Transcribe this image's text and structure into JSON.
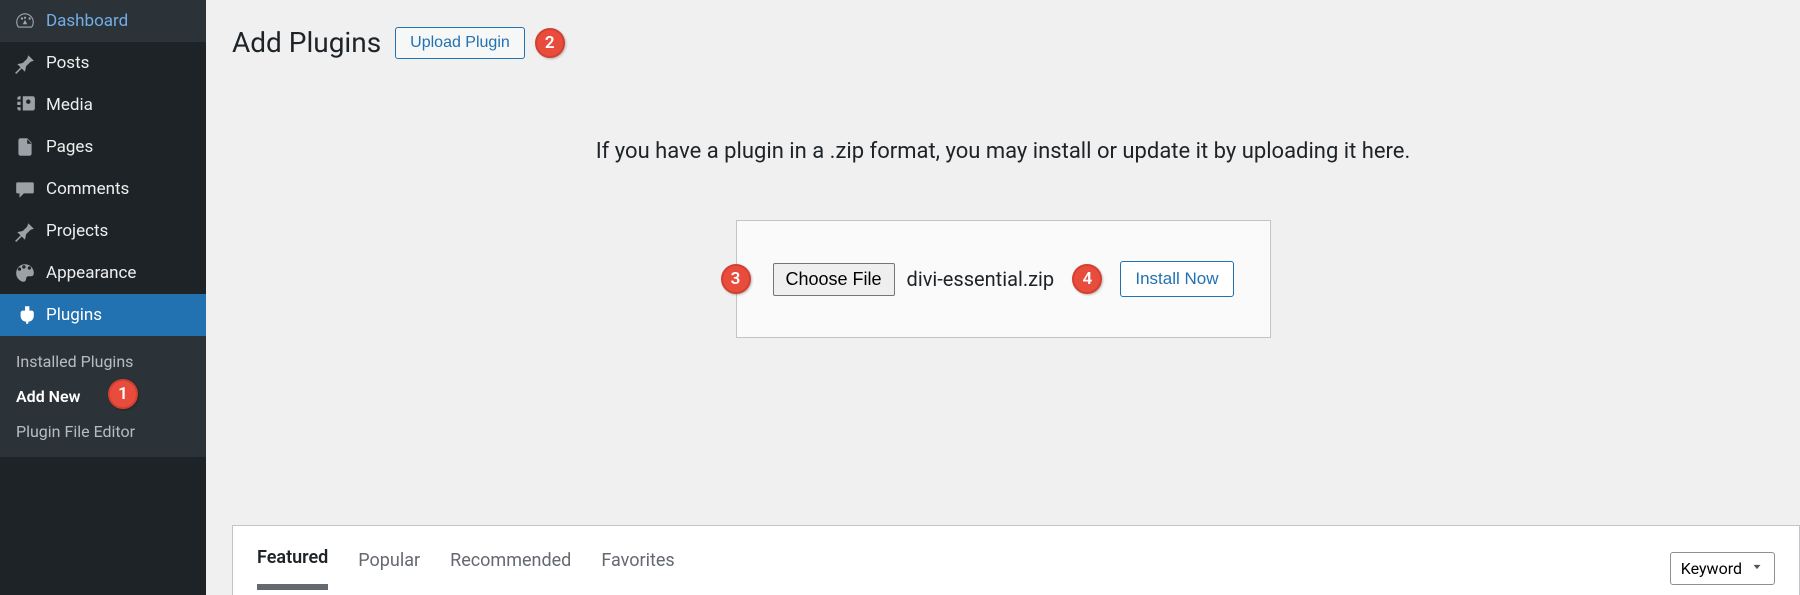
{
  "sidebar": {
    "items": [
      {
        "label": "Dashboard",
        "icon": "dashboard"
      },
      {
        "label": "Posts",
        "icon": "pin"
      },
      {
        "label": "Media",
        "icon": "media"
      },
      {
        "label": "Pages",
        "icon": "pages"
      },
      {
        "label": "Comments",
        "icon": "comments"
      },
      {
        "label": "Projects",
        "icon": "pin"
      },
      {
        "label": "Appearance",
        "icon": "appearance"
      },
      {
        "label": "Plugins",
        "icon": "plugins"
      }
    ],
    "submenu": {
      "items": [
        {
          "label": "Installed Plugins"
        },
        {
          "label": "Add New"
        },
        {
          "label": "Plugin File Editor"
        }
      ]
    }
  },
  "header": {
    "title": "Add Plugins",
    "upload_button": "Upload Plugin"
  },
  "upload": {
    "message": "If you have a plugin in a .zip format, you may install or update it by uploading it here.",
    "choose_file_label": "Choose File",
    "file_name": "divi-essential.zip",
    "install_label": "Install Now"
  },
  "filters": {
    "tabs": [
      "Featured",
      "Popular",
      "Recommended",
      "Favorites"
    ],
    "search_type": "Keyword"
  },
  "callouts": {
    "c1": "1",
    "c2": "2",
    "c3": "3",
    "c4": "4"
  }
}
